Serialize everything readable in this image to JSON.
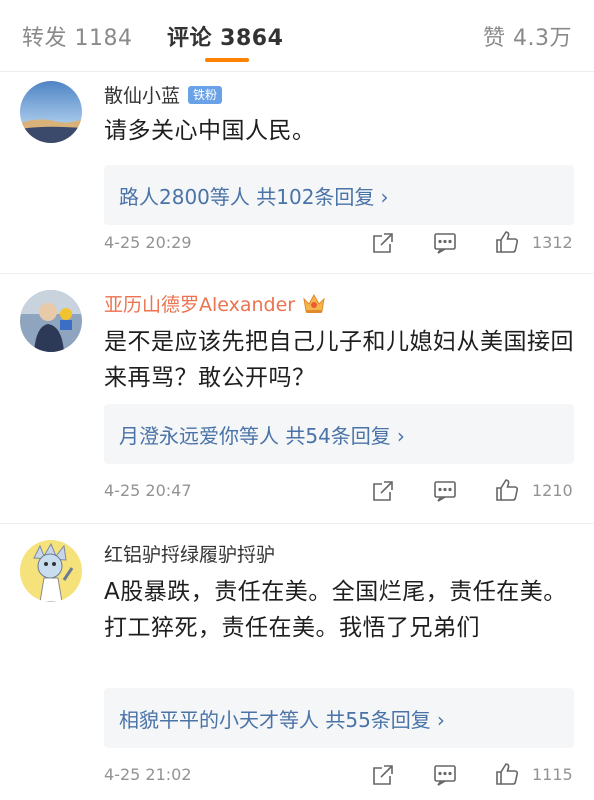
{
  "tabs": {
    "repost": "转发 1184",
    "comments": "评论 3864",
    "likes": "赞 4.3万"
  },
  "colors": {
    "accent": "#ff8200",
    "link": "#4a73a8",
    "vip_name": "#eb7350",
    "normal_name": "#333333",
    "meta": "#939393"
  },
  "comments": [
    {
      "username": "散仙小蓝",
      "badge": "铁粉",
      "text": "请多关心中国人民。",
      "reply_summary": "路人2800等人 共102条回复",
      "time": "4-25 20:29",
      "like_count": "1312"
    },
    {
      "username": "亚历山德罗Alexander",
      "badge_icon": "crown-icon",
      "text": "是不是应该先把自己儿子和儿媳妇从美国接回来再骂？敢公开吗？",
      "reply_summary": "月澄永远爱你等人 共54条回复",
      "time": "4-25 20:47",
      "like_count": "1210"
    },
    {
      "username": "红铝驴捋绿履驴捋驴",
      "text": "A股暴跌，责任在美。全国烂尾，责任在美。打工猝死，责任在美。我悟了兄弟们",
      "reply_summary": "相貌平平的小天才等人 共55条回复",
      "time": "4-25 21:02",
      "like_count": "1115"
    }
  ],
  "icons": {
    "repost": "share-icon",
    "comment": "comment-icon",
    "like": "thumbs-up-icon",
    "chevron": "chevron-right-icon"
  }
}
